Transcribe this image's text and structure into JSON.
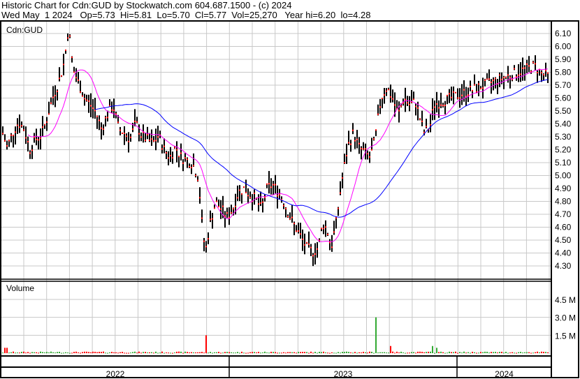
{
  "header": {
    "title": "Historic Chart for Cdn:GUD by Stockwatch.com 604.687.1500 - (c) 2024",
    "quote": "Wed May  1 2024   Op=5.73  Hi=5.81  Lo=5.70  Cl=5.77  Vol=25,270   Year hi=6.20  lo=4.28"
  },
  "chart_data": {
    "type": "line",
    "symbol": "Cdn:GUD",
    "price_axis": {
      "ylim": [
        4.2,
        6.2
      ],
      "ticks": [
        "6.10",
        "6.00",
        "5.90",
        "5.80",
        "5.70",
        "5.60",
        "5.50",
        "5.40",
        "5.30",
        "5.20",
        "5.10",
        "5.00",
        "4.90",
        "4.80",
        "4.70",
        "4.60",
        "4.50",
        "4.40",
        "4.30"
      ]
    },
    "time_axis": {
      "range_years": [
        2022.0,
        2024.36
      ],
      "year_labels": [
        {
          "label": "2022",
          "start": 2022.0,
          "end": 2023.0
        },
        {
          "label": "2023",
          "start": 2023.0,
          "end": 2024.0
        },
        {
          "label": "2024",
          "start": 2024.0,
          "end": 2024.36
        }
      ]
    },
    "close_series": {
      "t": [
        2022.0,
        2022.025,
        2022.05,
        2022.075,
        2022.1,
        2022.125,
        2022.15,
        2022.175,
        2022.2,
        2022.225,
        2022.25,
        2022.275,
        2022.295,
        2022.315,
        2022.34,
        2022.365,
        2022.39,
        2022.415,
        2022.44,
        2022.465,
        2022.49,
        2022.515,
        2022.54,
        2022.565,
        2022.59,
        2022.615,
        2022.64,
        2022.665,
        2022.69,
        2022.715,
        2022.74,
        2022.765,
        2022.79,
        2022.815,
        2022.84,
        2022.865,
        2022.883,
        2022.896,
        2022.916,
        2022.941,
        2022.966,
        2022.991,
        2023.016,
        2023.041,
        2023.066,
        2023.091,
        2023.116,
        2023.141,
        2023.166,
        2023.191,
        2023.216,
        2023.241,
        2023.266,
        2023.291,
        2023.316,
        2023.341,
        2023.367,
        2023.392,
        2023.41,
        2023.43,
        2023.448,
        2023.469,
        2023.494,
        2023.52,
        2023.545,
        2023.57,
        2023.6,
        2023.62,
        2023.64,
        2023.667,
        2023.692,
        2023.717,
        2023.742,
        2023.767,
        2023.792,
        2023.818,
        2023.838,
        2023.857,
        2023.883,
        2023.9
      ],
      "close": [
        5.36,
        5.22,
        5.33,
        5.41,
        5.36,
        5.2,
        5.28,
        5.31,
        5.44,
        5.6,
        5.71,
        5.87,
        6.15,
        5.82,
        5.71,
        5.6,
        5.55,
        5.49,
        5.36,
        5.47,
        5.55,
        5.36,
        5.33,
        5.28,
        5.41,
        5.31,
        5.28,
        5.25,
        5.31,
        5.2,
        5.14,
        5.22,
        5.14,
        5.12,
        5.09,
        4.98,
        4.58,
        4.41,
        4.63,
        4.79,
        4.74,
        4.68,
        4.74,
        4.87,
        4.9,
        4.85,
        4.82,
        4.74,
        4.9,
        4.93,
        4.87,
        4.79,
        4.68,
        4.6,
        4.52,
        4.44,
        4.41,
        4.44,
        4.63,
        4.58,
        4.44,
        4.63,
        4.95,
        5.22,
        5.33,
        5.22,
        5.17,
        5.14,
        5.28,
        5.6,
        5.68,
        5.6,
        5.47,
        5.6,
        5.55,
        5.57,
        5.44,
        5.33,
        5.39,
        5.55
      ]
    },
    "close_tail": {
      "t": [
        2023.92,
        2023.94,
        2023.96
      ],
      "close": [
        5.85,
        5.79,
        5.77
      ]
    },
    "series": [
      {
        "name": "Price (high-low bars)",
        "color": "#000000",
        "close_marker_color": "#ff0000"
      },
      {
        "name": "Short moving average",
        "color": "#ff00ff"
      },
      {
        "name": "Long moving average",
        "color": "#0000ff"
      }
    ],
    "volume": {
      "label": "Volume",
      "ticks": [
        "4.5 M",
        "3.0 M",
        "1.5 M"
      ],
      "ylim_millions": [
        0,
        5.2
      ],
      "typical_millions": 0.08,
      "spikes": [
        {
          "t": 2022.02,
          "millions": 0.45
        },
        {
          "t": 2022.9,
          "millions": 1.5
        },
        {
          "t": 2023.71,
          "millions": 0.6
        },
        {
          "t": 2023.64,
          "millions": 3.0
        },
        {
          "t": 2023.89,
          "millions": 0.6
        },
        {
          "t": 2023.91,
          "millions": 0.45
        }
      ],
      "up_color": "#33aa33",
      "down_color": "#ff0000"
    }
  }
}
